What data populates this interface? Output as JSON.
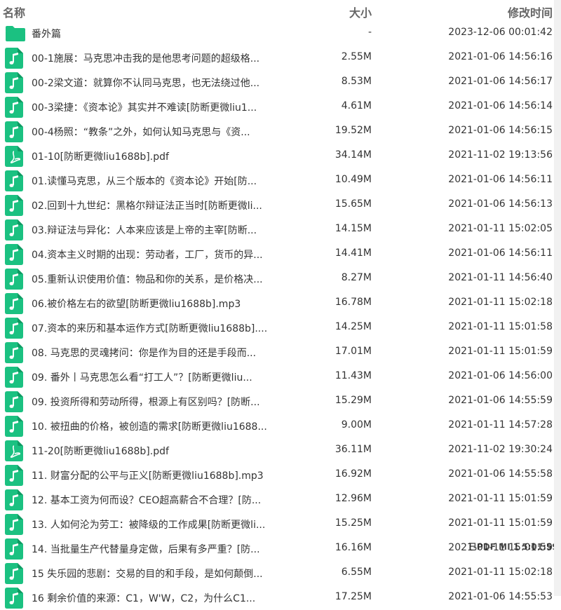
{
  "header": {
    "name": "名称",
    "size": "大小",
    "modified": "修改时间"
  },
  "colors": {
    "file_icon": "#1bc181",
    "folder_icon": "#1bc181"
  },
  "files": [
    {
      "icon": "folder",
      "name": "番外篇",
      "size": "-",
      "time": "2023-12-06 00:01:42"
    },
    {
      "icon": "audio",
      "name": "00-1施展：马克思冲击我的是他思考问题的超级格...",
      "size": "2.55M",
      "time": "2021-01-06 14:56:16"
    },
    {
      "icon": "audio",
      "name": "00-2梁文道：就算你不认同马克思，也无法绕过他...",
      "size": "8.53M",
      "time": "2021-01-06 14:56:17"
    },
    {
      "icon": "audio",
      "name": "00-3梁捷：《资本论》其实并不难读[防断更微liu1...",
      "size": "4.61M",
      "time": "2021-01-06 14:56:14"
    },
    {
      "icon": "audio",
      "name": "00-4杨照：“教条”之外，如何认知马克思与《资...",
      "size": "19.52M",
      "time": "2021-01-06 14:56:15"
    },
    {
      "icon": "pdf",
      "name": "01-10[防断更微liu1688b].pdf",
      "size": "34.14M",
      "time": "2021-11-02 19:13:56"
    },
    {
      "icon": "audio",
      "name": "01.读懂马克思，从三个版本的《资本论》开始[防...",
      "size": "10.49M",
      "time": "2021-01-06 14:56:11"
    },
    {
      "icon": "audio",
      "name": "02.回到十九世纪：黑格尔辩证法正当时[防断更微li...",
      "size": "15.65M",
      "time": "2021-01-06 14:56:13"
    },
    {
      "icon": "audio",
      "name": "03.辩证法与异化：人本来应该是上帝的主宰[防断...",
      "size": "14.15M",
      "time": "2021-01-11 15:02:05"
    },
    {
      "icon": "audio",
      "name": "04.资本主义时期的出现：劳动者，工厂，货币的异...",
      "size": "14.41M",
      "time": "2021-01-06 14:56:11"
    },
    {
      "icon": "audio",
      "name": "05.重新认识使用价值：物品和你的关系，是价格决...",
      "size": "8.27M",
      "time": "2021-01-11 14:56:40"
    },
    {
      "icon": "audio",
      "name": "06.被价格左右的欲望[防断更微liu1688b].mp3",
      "size": "16.78M",
      "time": "2021-01-11 15:02:18"
    },
    {
      "icon": "audio",
      "name": "07.资本的来历和基本运作方式[防断更微liu1688b]....",
      "size": "14.25M",
      "time": "2021-01-11 15:01:58"
    },
    {
      "icon": "audio",
      "name": "08. 马克思的灵魂拷问：你是作为目的还是手段而...",
      "size": "17.01M",
      "time": "2021-01-11 15:01:59"
    },
    {
      "icon": "audio",
      "name": "09. 番外丨马克思怎么看“打工人”？[防断更微liu...",
      "size": "11.43M",
      "time": "2021-01-06 14:56:00"
    },
    {
      "icon": "audio",
      "name": "09. 投资所得和劳动所得，根源上有区别吗？[防断...",
      "size": "15.29M",
      "time": "2021-01-06 14:55:59"
    },
    {
      "icon": "audio",
      "name": "10. 被扭曲的价格，被创造的需求[防断更微liu1688...",
      "size": "9.00M",
      "time": "2021-01-11 14:57:28"
    },
    {
      "icon": "pdf",
      "name": "11-20[防断更微liu1688b].pdf",
      "size": "36.11M",
      "time": "2021-11-02 19:30:24"
    },
    {
      "icon": "audio",
      "name": "11. 财富分配的公平与正义[防断更微liu1688b].mp3",
      "size": "16.92M",
      "time": "2021-01-06 14:55:58"
    },
    {
      "icon": "audio",
      "name": "12. 基本工资为何而设？CEO超高薪合不合理？[防...",
      "size": "12.96M",
      "time": "2021-01-11 15:01:59"
    },
    {
      "icon": "audio",
      "name": "13. 人如何沦为劳工：被降级的工作成果[防断更微li...",
      "size": "15.25M",
      "time": "2021-01-11 15:01:59"
    },
    {
      "icon": "audio",
      "name": "14. 当批量生产代替量身定做，后果有多严重？[防...",
      "size": "16.16M",
      "time": "2021-01-11 15:01:59"
    },
    {
      "icon": "audio",
      "name": "15 失乐园的悲剧：交易的目的和手段，是如何颠倒...",
      "size": "6.55M",
      "time": "2021-01-11 15:02:18"
    },
    {
      "icon": "audio",
      "name": "16 剩余价值的来源：C1，W'W，C2，为什么C1...",
      "size": "17.25M",
      "time": "2021-01-06 14:55:53"
    }
  ],
  "watermark": "已PDF MI 1 5:01:59"
}
